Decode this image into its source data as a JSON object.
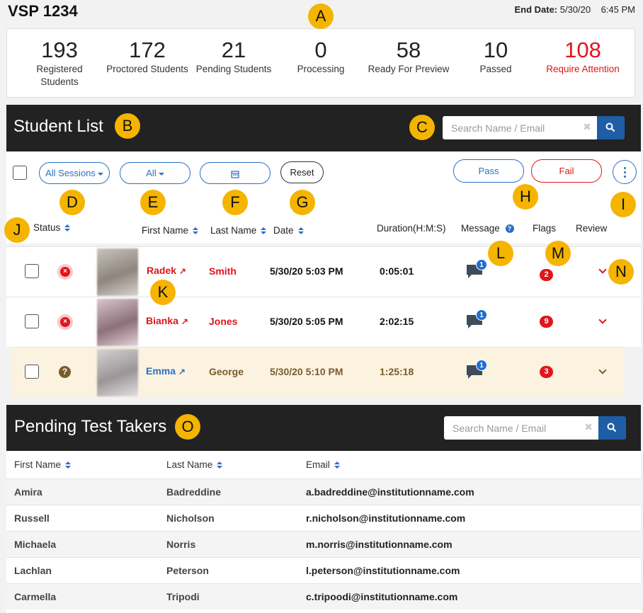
{
  "header": {
    "title": "VSP 1234",
    "end_date_label": "End Date:",
    "end_date_value": "5/30/20",
    "end_time": "6:45 PM"
  },
  "stats": [
    {
      "value": "193",
      "label_line1": "Registered",
      "label_line2": "Students"
    },
    {
      "value": "172",
      "label_line1": "Proctored Students",
      "label_line2": ""
    },
    {
      "value": "21",
      "label_line1": "Pending Students",
      "label_line2": ""
    },
    {
      "value": "0",
      "label_line1": "Processing",
      "label_line2": ""
    },
    {
      "value": "58",
      "label_line1": "Ready For Preview",
      "label_line2": ""
    },
    {
      "value": "10",
      "label_line1": "Passed",
      "label_line2": ""
    },
    {
      "value": "108",
      "label_line1": "Require Attention",
      "label_line2": ""
    }
  ],
  "student_list": {
    "title": "Student List",
    "search_placeholder": "Search Name / Email",
    "filters": {
      "sessions": "All Sessions",
      "all": "All",
      "reset": "Reset",
      "pass": "Pass",
      "fail": "Fail"
    },
    "columns": {
      "status": "Status",
      "first_name": "First Name",
      "last_name": "Last Name",
      "date": "Date",
      "duration": "Duration(H:M:S)",
      "message": "Message",
      "flags": "Flags",
      "review": "Review"
    },
    "rows": [
      {
        "first": "Radek",
        "last": "Smith",
        "date": "5/30/20 5:03 PM",
        "duration": "0:05:01",
        "messages": "1",
        "flags": "2",
        "status": "failed"
      },
      {
        "first": "Bianka",
        "last": "Jones",
        "date": "5/30/20 5:05 PM",
        "duration": "2:02:15",
        "messages": "1",
        "flags": "9",
        "status": "failed"
      },
      {
        "first": "Emma",
        "last": "George",
        "date": "5/30/20 5:10 PM",
        "duration": "1:25:18",
        "messages": "1",
        "flags": "3",
        "status": "unknown"
      }
    ]
  },
  "pending": {
    "title": "Pending Test Takers",
    "search_placeholder": "Search Name / Email",
    "columns": {
      "first_name": "First Name",
      "last_name": "Last Name",
      "email": "Email"
    },
    "rows": [
      {
        "first": "Amira",
        "last": "Badreddine",
        "email": "a.badreddine@institutionname.com"
      },
      {
        "first": "Russell",
        "last": "Nicholson",
        "email": "r.nicholson@institutionname.com"
      },
      {
        "first": "Michaela",
        "last": "Norris",
        "email": "m.norris@institutionname.com"
      },
      {
        "first": "Lachlan",
        "last": "Peterson",
        "email": "l.peterson@institutionname.com"
      },
      {
        "first": "Carmella",
        "last": "Tripodi",
        "email": "c.tripoodi@institutionname.com"
      }
    ]
  },
  "callouts": [
    "A",
    "B",
    "C",
    "D",
    "E",
    "F",
    "G",
    "H",
    "I",
    "J",
    "K",
    "L",
    "M",
    "N",
    "O"
  ],
  "colors": {
    "accent": "#2a6fc5",
    "danger": "#e0161b",
    "callout": "#f5b400",
    "bar": "#222222",
    "highlight_row": "#fbf3e0"
  }
}
